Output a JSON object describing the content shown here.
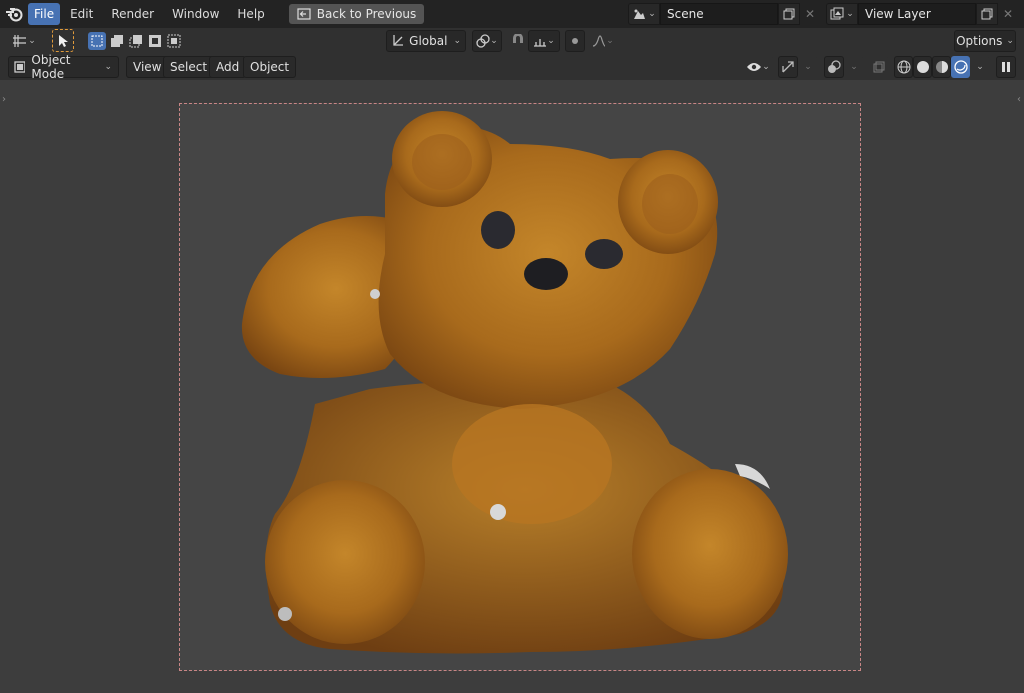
{
  "topbar": {
    "menus": [
      "File",
      "Edit",
      "Render",
      "Window",
      "Help"
    ],
    "back_button": "Back to Previous",
    "scene": {
      "label": "Scene"
    },
    "view_layer": {
      "label": "View Layer"
    }
  },
  "toolbar": {
    "orientation": "Global",
    "options": "Options"
  },
  "header": {
    "mode": "Object Mode",
    "menus": [
      "View",
      "Select",
      "Add",
      "Object"
    ]
  },
  "colors": {
    "accent": "#4772b3",
    "camera_frame": "#c98686",
    "viewport_bg": "#3d3d3d",
    "bear": "#b5781f"
  }
}
